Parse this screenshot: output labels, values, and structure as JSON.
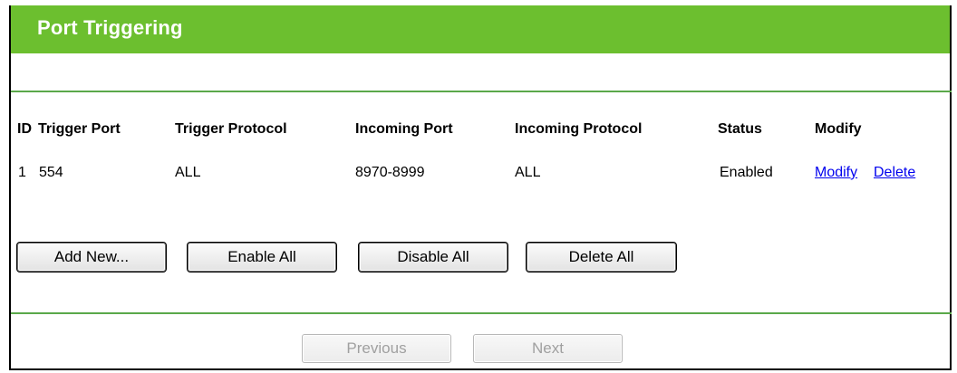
{
  "page": {
    "title": "Port Triggering"
  },
  "table": {
    "headers": {
      "id": "ID",
      "trigger_port": "Trigger Port",
      "trigger_protocol": "Trigger Protocol",
      "incoming_port": "Incoming Port",
      "incoming_protocol": "Incoming Protocol",
      "status": "Status",
      "modify": "Modify"
    },
    "rows": [
      {
        "id": "1",
        "trigger_port": "554",
        "trigger_protocol": "ALL",
        "incoming_port": "8970-8999",
        "incoming_protocol": "ALL",
        "status": "Enabled",
        "modify_link": "Modify",
        "delete_link": "Delete"
      }
    ]
  },
  "actions": {
    "add_new": "Add New...",
    "enable_all": "Enable All",
    "disable_all": "Disable All",
    "delete_all": "Delete All"
  },
  "pagination": {
    "previous": "Previous",
    "next": "Next"
  },
  "colors": {
    "header": "#6cbf2f",
    "divider": "#5aa84a",
    "link": "#0000ee"
  }
}
